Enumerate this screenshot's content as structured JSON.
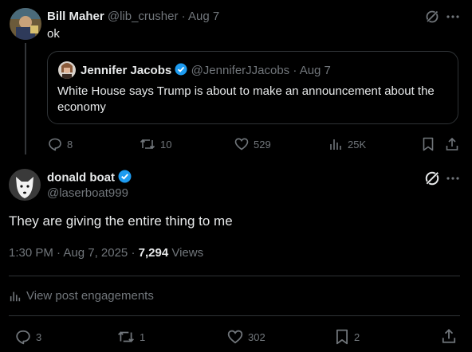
{
  "reply_post": {
    "author_name": "Bill Maher",
    "handle": "@lib_crusher",
    "time": "Aug 7",
    "text": "ok",
    "actions": {
      "replies": "8",
      "reposts": "10",
      "likes": "529",
      "views": "25K"
    }
  },
  "quoted_post": {
    "author_name": "Jennifer Jacobs",
    "handle": "@JenniferJJacobs",
    "time": "Aug 7",
    "text_line1": "White House says Trump is about to make an announcement about the",
    "text_line2": "economy"
  },
  "main_post": {
    "author_name": "donald boat",
    "handle": "@laserboat999",
    "text": "They are giving the entire thing to me",
    "timestamp": "1:30 PM · Aug 7, 2025",
    "views_count": "7,294",
    "views_label": "Views",
    "engagements_label": "View post engagements",
    "actions": {
      "replies": "3",
      "reposts": "1",
      "likes": "302",
      "bookmarks": "2"
    }
  },
  "colors": {
    "background": "#000000",
    "text": "#e7e9ea",
    "muted": "#71767b",
    "verified": "#1d9bf0",
    "divider": "#2f3336"
  }
}
